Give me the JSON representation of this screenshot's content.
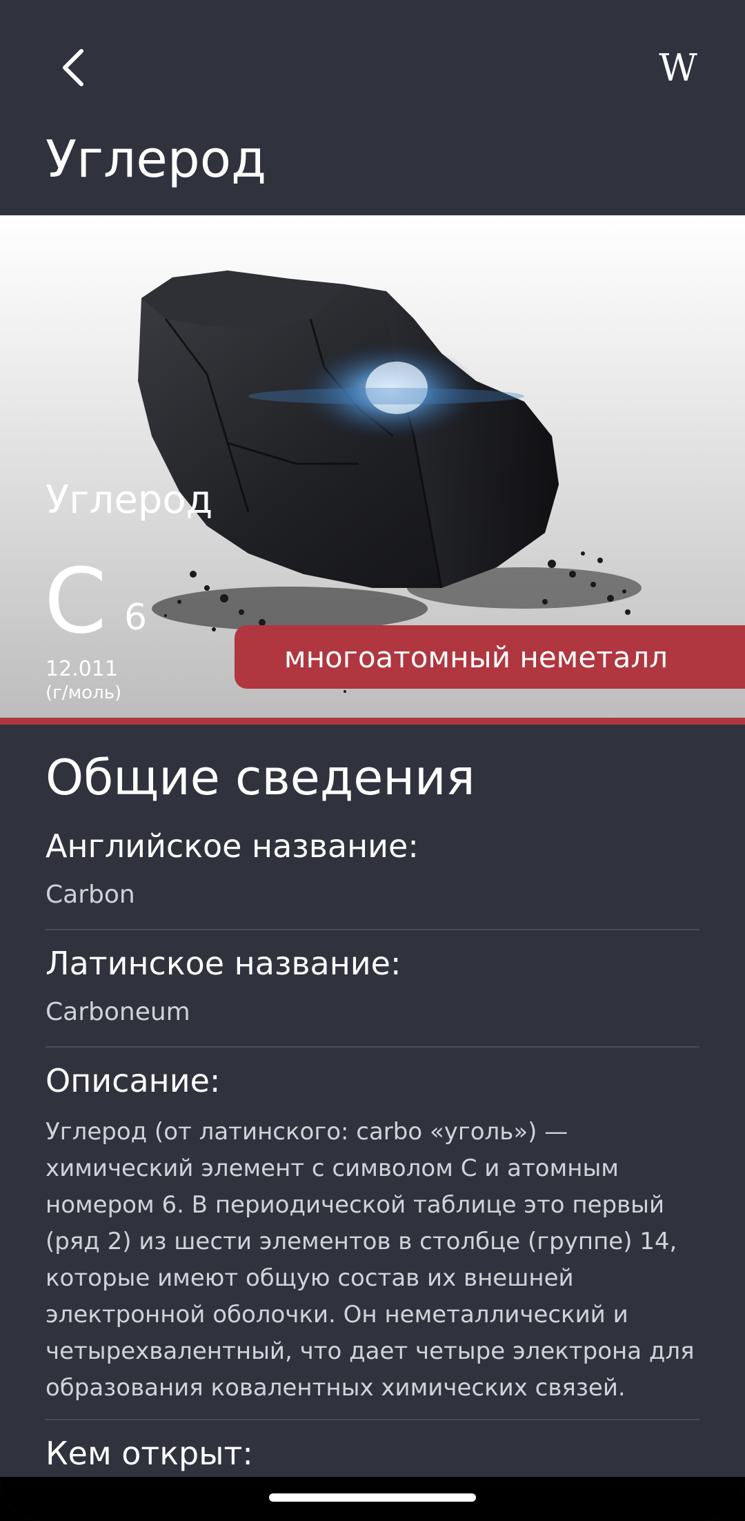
{
  "header": {
    "title": "Углерод",
    "wiki_label": "W"
  },
  "element": {
    "name": "Углерод",
    "symbol": "C",
    "atomic_number": "6",
    "atomic_mass": "12.011",
    "mass_unit": "(г/моль)",
    "category": "многоатомный неметалл"
  },
  "colors": {
    "background": "#30323e",
    "accent": "#b0363f",
    "text": "#ffffff",
    "secondary_text": "#d2d3d9"
  },
  "section": {
    "title": "Общие сведения",
    "fields": [
      {
        "label": "Английское название:",
        "value": "Carbon"
      },
      {
        "label": "Латинское название:",
        "value": "Carboneum"
      },
      {
        "label": "Описание:",
        "value": "Углерод (от латинского: carbo «уголь») — химический элемент с символом C и атомным номером 6. В периодической таблице это первый (ряд 2) из шести элементов в столбце (группе) 14, которые имеют общую состав их внешней электронной оболочки. Он неметаллический и четырехвалентный, что дает четыре электрона для образования ковалентных химических связей."
      },
      {
        "label": "Кем открыт:",
        "value": ""
      }
    ]
  },
  "icons": {
    "back": "chevron-left-icon",
    "wiki": "wikipedia-icon"
  }
}
